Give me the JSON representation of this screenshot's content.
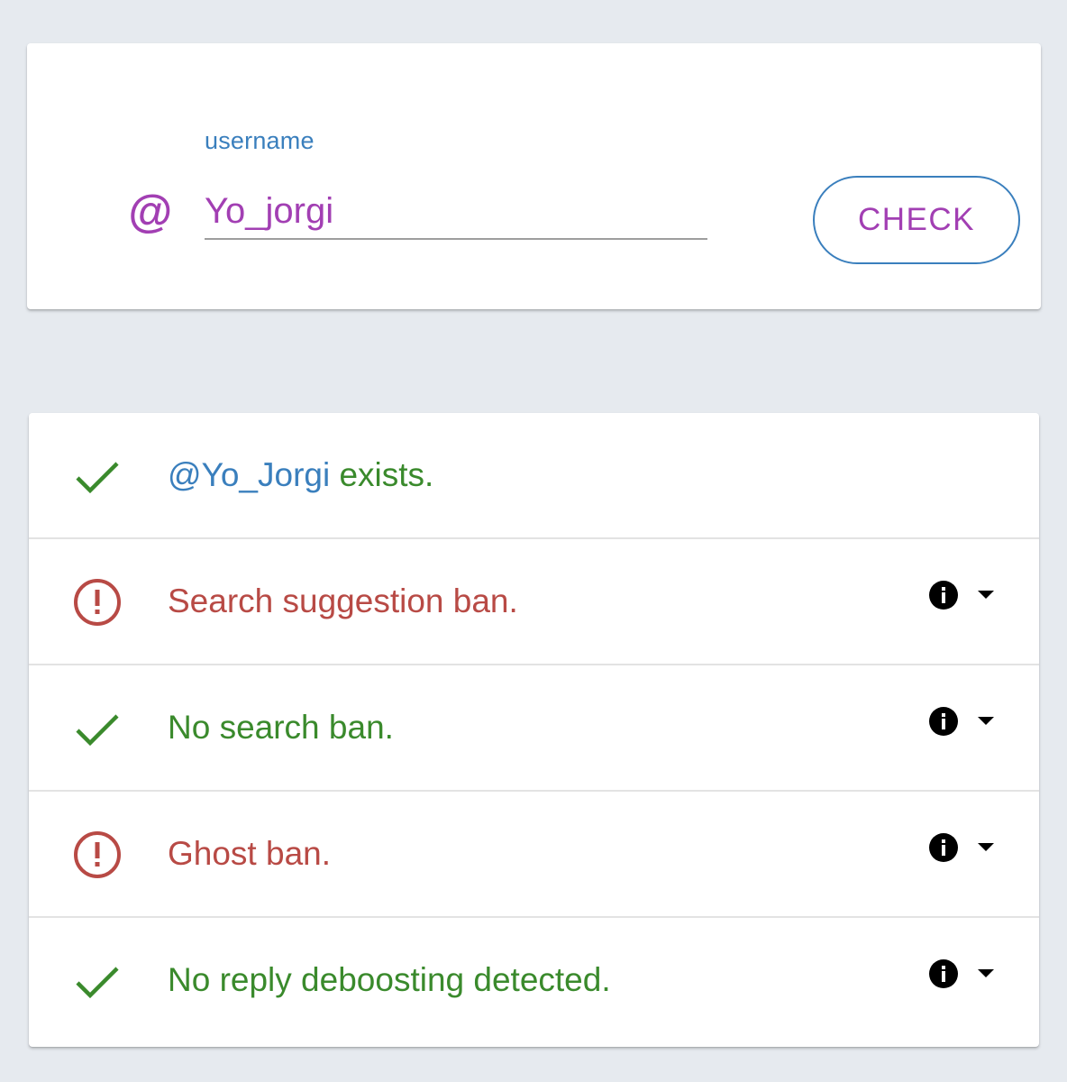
{
  "search": {
    "at_symbol": "@",
    "label": "username",
    "value": "Yo_jorgi",
    "button_label": "CHECK"
  },
  "results": [
    {
      "status": "ok",
      "icon": "check-icon",
      "mention": "@Yo_Jorgi",
      "text": " exists.",
      "has_info": false
    },
    {
      "status": "bad",
      "icon": "alert-circle-icon",
      "text": "Search suggestion ban.",
      "has_info": true
    },
    {
      "status": "ok",
      "icon": "check-icon",
      "text": "No search ban.",
      "has_info": true
    },
    {
      "status": "bad",
      "icon": "alert-circle-icon",
      "text": "Ghost ban.",
      "has_info": true
    },
    {
      "status": "ok",
      "icon": "check-icon",
      "text": "No reply deboosting detected.",
      "has_info": true
    }
  ],
  "colors": {
    "background": "#e6eaef",
    "ok_green": "#3a8a2c",
    "bad_red": "#b84a45",
    "accent_blue": "#3a7fbd",
    "accent_purple": "#a23fb3"
  }
}
